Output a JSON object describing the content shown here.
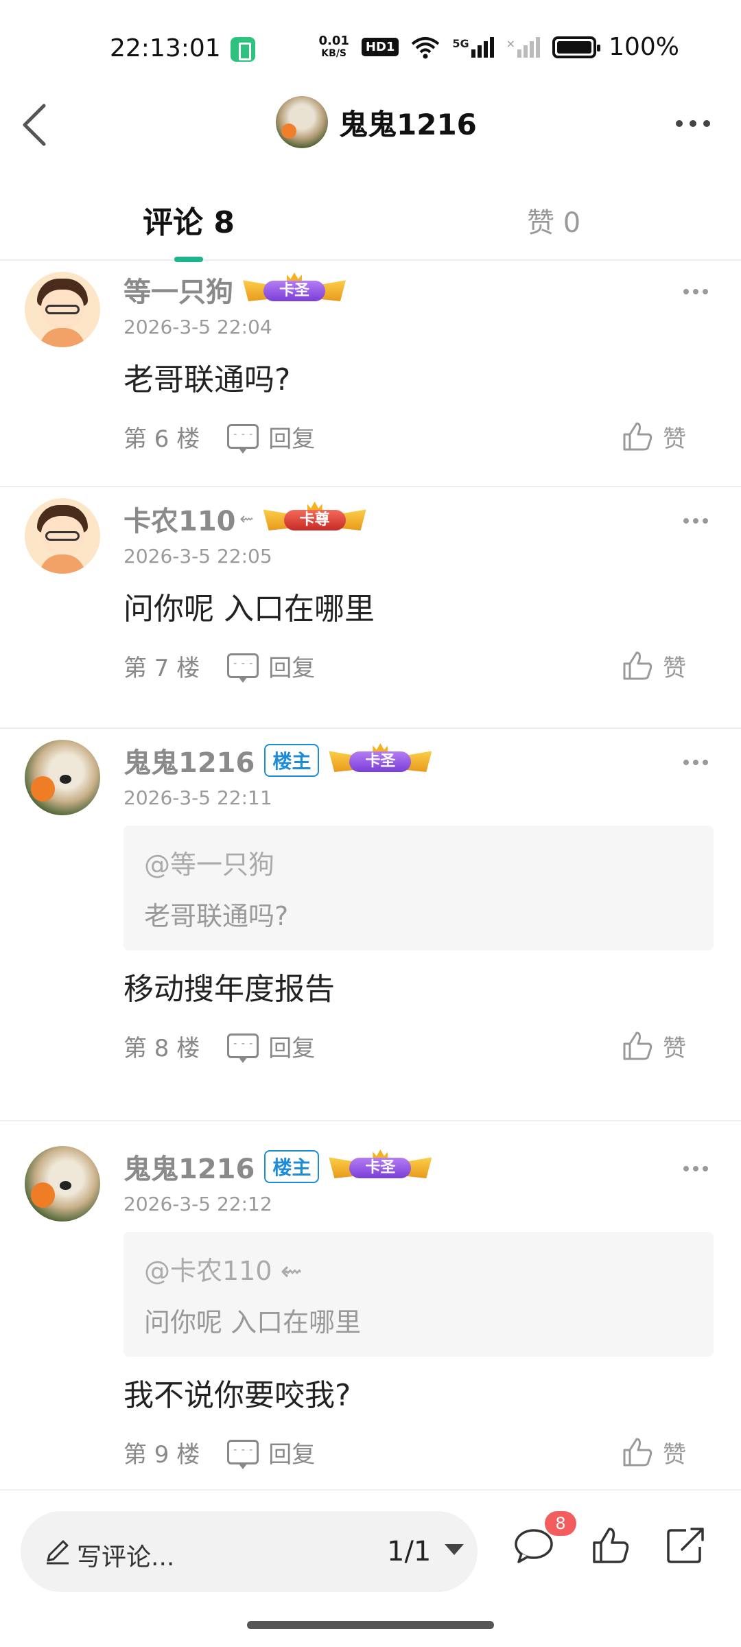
{
  "status_bar": {
    "time": "22:13:01",
    "net_speed_value": "0.01",
    "net_speed_unit": "KB/S",
    "hd_label": "HD1",
    "network_label": "5G",
    "battery_percent": "100%"
  },
  "header": {
    "title": "鬼鬼1216"
  },
  "tabs": {
    "comments": "评论 8",
    "likes": "赞 0"
  },
  "comments": [
    {
      "avatar": "kid-avatar",
      "name": "等一只狗",
      "name_suffix": "",
      "is_owner": false,
      "rank_badge": "卡圣",
      "time": "2026-3-5 22:04",
      "quote_at": "",
      "quote_text": "",
      "text": "老哥联通吗?",
      "floor": "第 6 楼",
      "reply_label": "回复",
      "like_label": "赞"
    },
    {
      "avatar": "kid-avatar",
      "name": "卡农110",
      "name_suffix": "⇜",
      "is_owner": false,
      "rank_badge": "卡尊",
      "time": "2026-3-5 22:05",
      "quote_at": "",
      "quote_text": "",
      "text": "问你呢 入口在哪里",
      "floor": "第 7 楼",
      "reply_label": "回复",
      "like_label": "赞"
    },
    {
      "avatar": "dog-avatar",
      "name": "鬼鬼1216",
      "name_suffix": "",
      "is_owner": true,
      "owner_label": "楼主",
      "rank_badge": "卡圣",
      "time": "2026-3-5 22:11",
      "quote_at": "@等一只狗",
      "quote_text": "老哥联通吗?",
      "text": "移动搜年度报告",
      "floor": "第 8 楼",
      "reply_label": "回复",
      "like_label": "赞"
    },
    {
      "avatar": "dog-avatar",
      "name": "鬼鬼1216",
      "name_suffix": "",
      "is_owner": true,
      "owner_label": "楼主",
      "rank_badge": "卡圣",
      "time": "2026-3-5 22:12",
      "quote_at": "@卡农110 ⇜",
      "quote_text": "问你呢 入口在哪里",
      "text": "我不说你要咬我?",
      "floor": "第 9 楼",
      "reply_label": "回复",
      "like_label": "赞"
    }
  ],
  "bottom_bar": {
    "write_placeholder": "写评论...",
    "page_indicator": "1/1",
    "comment_count_badge": "8"
  },
  "colors": {
    "accent_green": "#1fb48d",
    "owner_blue": "#1e8bd8",
    "badge_red": "#f35d5d"
  }
}
